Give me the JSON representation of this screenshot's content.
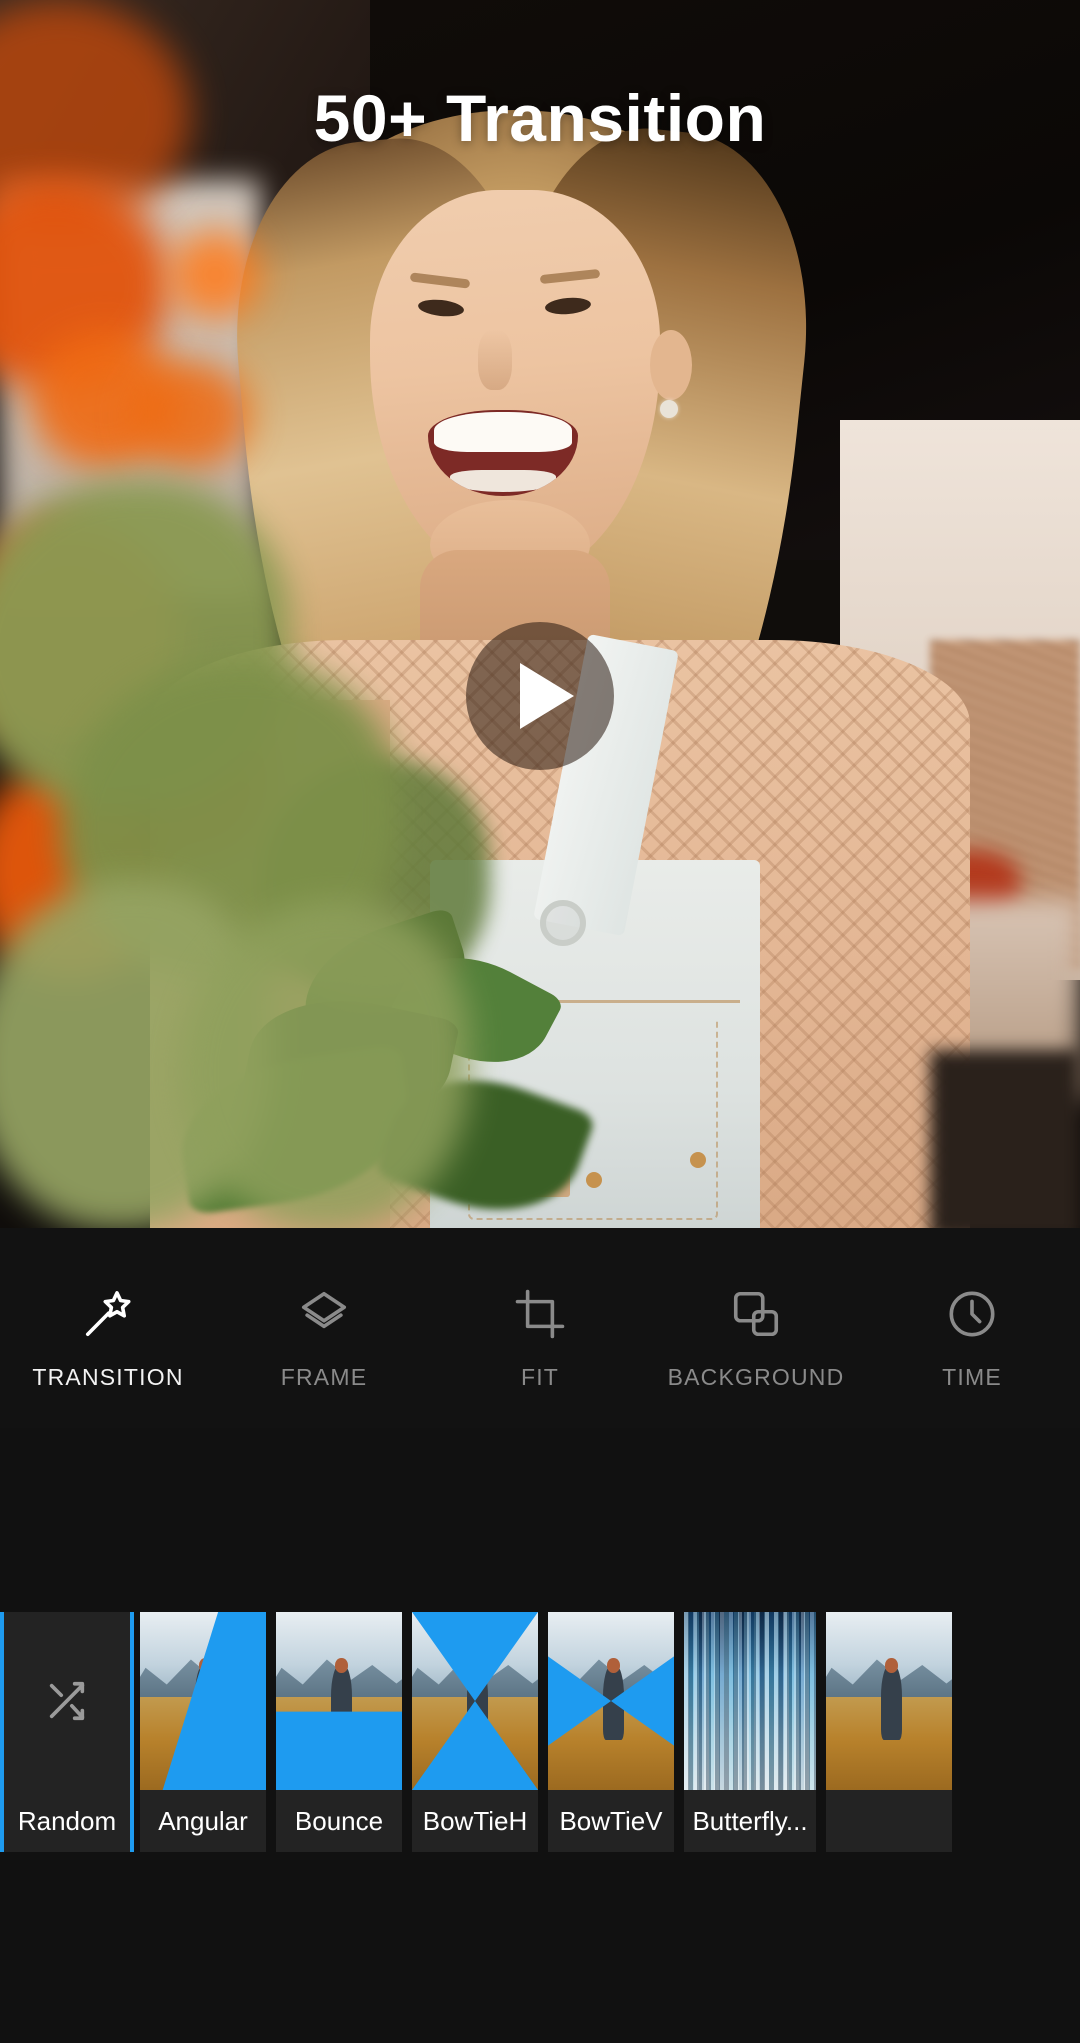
{
  "preview": {
    "title": "50+ Transition",
    "play_icon": "play-icon"
  },
  "toolbar": {
    "items": [
      {
        "label": "TRANSITION",
        "icon": "magic-wand-icon",
        "active": true
      },
      {
        "label": "FRAME",
        "icon": "layers-icon",
        "active": false
      },
      {
        "label": "FIT",
        "icon": "crop-icon",
        "active": false
      },
      {
        "label": "BACKGROUND",
        "icon": "squares-icon",
        "active": false
      },
      {
        "label": "TIME",
        "icon": "clock-icon",
        "active": false
      }
    ]
  },
  "transitions": {
    "selected": "Random",
    "items": [
      {
        "label": "Random",
        "icon": "shuffle-icon",
        "style": "random",
        "selected": true
      },
      {
        "label": "Angular",
        "style": "angular",
        "selected": false
      },
      {
        "label": "Bounce",
        "style": "bounce",
        "selected": false
      },
      {
        "label": "BowTieH",
        "style": "bowtieh",
        "selected": false
      },
      {
        "label": "BowTieV",
        "style": "bowtiev",
        "selected": false
      },
      {
        "label": "Butterfly...",
        "style": "butterfly",
        "selected": false
      },
      {
        "label": "",
        "style": "partial",
        "selected": false
      }
    ]
  },
  "colors": {
    "accent": "#1e9bf0",
    "background": "#111111",
    "toolbar_bg": "#121212",
    "thumb_bg": "#232323",
    "label_active": "#f2f2f2",
    "label_inactive": "#8a8a8a"
  }
}
